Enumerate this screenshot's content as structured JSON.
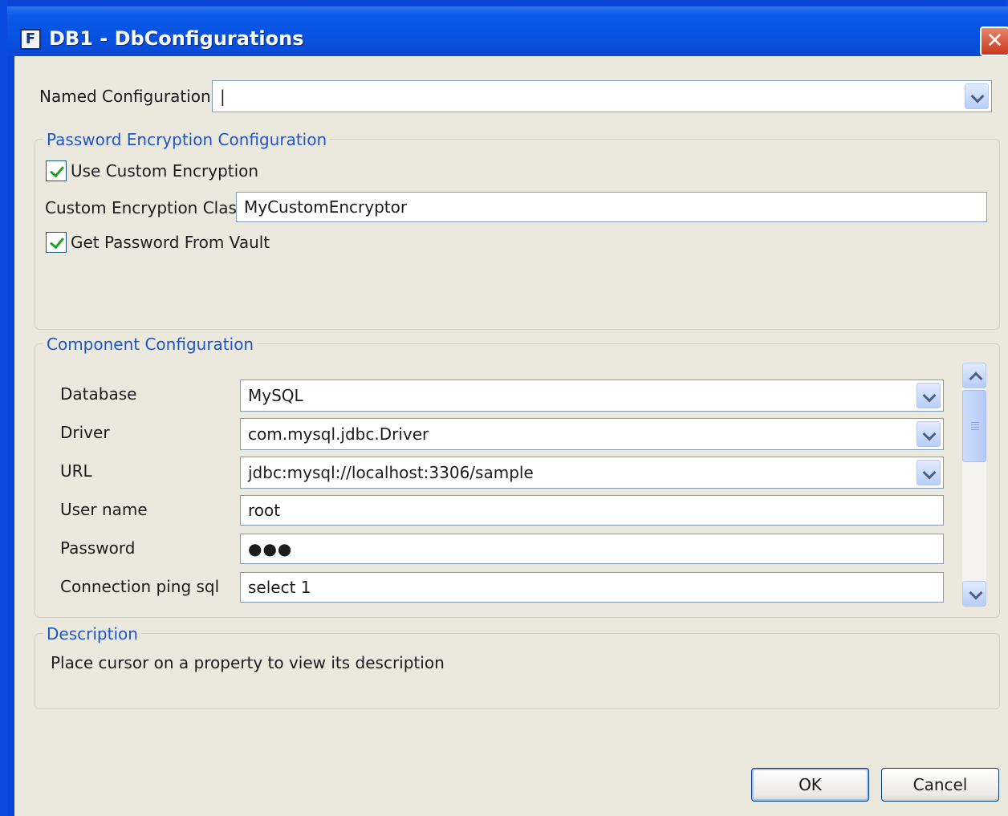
{
  "window": {
    "title": "DB1  - DbConfigurations",
    "app_icon": "F",
    "close_glyph": "✕"
  },
  "named_config": {
    "label": "Named Configuration",
    "value": "|"
  },
  "encryption": {
    "group_title": "Password Encryption Configuration",
    "use_custom": {
      "label": "Use Custom Encryption",
      "checked": true
    },
    "class_label": "Custom Encryption Clas",
    "class_value": "MyCustomEncryptor",
    "vault": {
      "label": "Get Password From Vault",
      "checked": true
    }
  },
  "component": {
    "group_title": "Component Configuration",
    "database": {
      "label": "Database",
      "value": "MySQL"
    },
    "driver": {
      "label": "Driver",
      "value": "com.mysql.jdbc.Driver"
    },
    "url": {
      "label": "URL",
      "value": "jdbc:mysql://localhost:3306/sample"
    },
    "username": {
      "label": "User name",
      "value": "root"
    },
    "password": {
      "label": "Password",
      "value": "●●●"
    },
    "ping": {
      "label": "Connection ping sql",
      "value": "select 1"
    }
  },
  "description": {
    "group_title": "Description",
    "text": "Place cursor on a property to view its description"
  },
  "buttons": {
    "ok": "OK",
    "cancel": "Cancel"
  },
  "colors": {
    "titlebar": "#0752e0",
    "dialog_bg": "#ebe9de",
    "group_title": "#1f55c8",
    "check": "#21a121"
  }
}
